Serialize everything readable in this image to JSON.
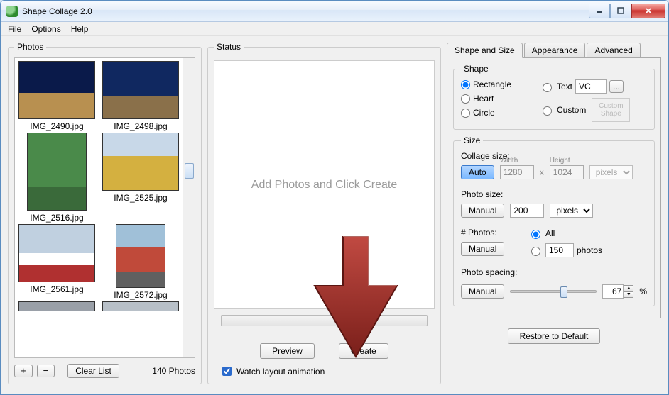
{
  "title": "Shape Collage 2.0",
  "menu": {
    "file": "File",
    "options": "Options",
    "help": "Help"
  },
  "photos": {
    "legend": "Photos",
    "items": [
      {
        "cap": "IMG_2490.jpg"
      },
      {
        "cap": "IMG_2498.jpg"
      },
      {
        "cap": "IMG_2516.jpg"
      },
      {
        "cap": "IMG_2525.jpg"
      },
      {
        "cap": "IMG_2561.jpg"
      },
      {
        "cap": "IMG_2572.jpg"
      }
    ],
    "add": "+",
    "remove": "−",
    "clear": "Clear List",
    "count": "140 Photos"
  },
  "status": {
    "legend": "Status",
    "placeholder": "Add Photos and Click Create",
    "preview": "Preview",
    "create": "Create",
    "watch": "Watch layout animation"
  },
  "tabs": {
    "shape": "Shape and Size",
    "appearance": "Appearance",
    "advanced": "Advanced"
  },
  "shape": {
    "legend": "Shape",
    "rectangle": "Rectangle",
    "heart": "Heart",
    "circle": "Circle",
    "text": "Text",
    "text_value": "VC",
    "ellipsis": "...",
    "custom": "Custom",
    "custom_hint": "Custom Shape"
  },
  "size": {
    "legend": "Size",
    "collage": "Collage size:",
    "auto": "Auto",
    "width_label": "Width",
    "height_label": "Height",
    "width": "1280",
    "height": "1024",
    "x": "x",
    "unit_pixels": "pixels",
    "photo": "Photo size:",
    "manual": "Manual",
    "photo_value": "200",
    "num": "# Photos:",
    "all": "All",
    "num_value": "150",
    "photos_suffix": "photos",
    "spacing": "Photo spacing:",
    "spacing_value": "67",
    "percent": "%"
  },
  "restore": "Restore to Default"
}
